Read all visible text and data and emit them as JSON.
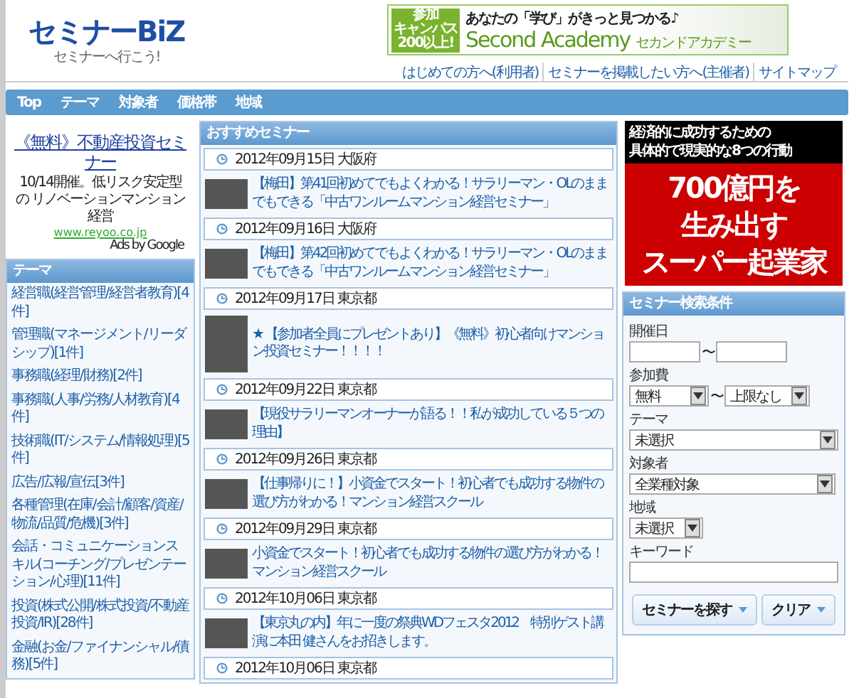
{
  "header": {
    "logo": "セミナーBiZ",
    "tagline": "セミナーへ行こう!",
    "banner": {
      "badge": [
        "参加",
        "キャンパス",
        "200以上!"
      ],
      "catch": "あなたの「学び」がきっと見つかる♪",
      "brand": "Second Academy",
      "brand_kana": "セカンドアカデミー"
    },
    "links": [
      "はじめての方へ(利用者)",
      "セミナーを掲載したい方へ(主催者)",
      "サイトマップ"
    ]
  },
  "nav": [
    "Top",
    "テーマ",
    "対象者",
    "価格帯",
    "地域"
  ],
  "ad": {
    "title": "《無料》不動産投資セミナー",
    "text": "10/14開催。低リスク安定型の リノベーションマンション経営",
    "url": "www.reyoo.co.jp",
    "credit": "Ads by Google"
  },
  "themes": {
    "title": "テーマ",
    "items": [
      "経営職(経営管理/経営者教育)[4件]",
      "管理職(マネージメント/リーダシップ)[1件]",
      "事務職(経理/財務)[2件]",
      "事務職(人事/労務/人材教育)[4件]",
      "技術職(IT/システム/情報処理)[5件]",
      "広告/広報/宣伝[3件]",
      "各種管理(在庫/会計/顧客/資産/物流/品質/危機)[3件]",
      "会話・コミュニケーションスキル(コーチング/プレゼンテーション/心理)[11件]",
      "投資(株式公開/株式投資/不動産投資/IR)[28件]",
      "金融(お金/ファイナンシャル/債務)[5件]"
    ]
  },
  "recommended": {
    "title": "おすすめセミナー",
    "items": [
      {
        "date": "2012年09月15日 大阪府",
        "tall": false,
        "title": "【梅田】第41回初めてでもよくわかる！サラリーマン・OLのままでもできる「中古ワンルームマンション経営セミナー」"
      },
      {
        "date": "2012年09月16日 大阪府",
        "tall": false,
        "title": "【梅田】第42回初めてでもよくわかる！サラリーマン・OLのままでもできる「中古ワンルームマンション経営セミナー」"
      },
      {
        "date": "2012年09月17日 東京都",
        "title": "★ 【参加者全員にプレゼントあり】《無料》初心者向けマンション投資セミナー！！！！",
        "tall": true
      },
      {
        "date": "2012年09月22日 東京都",
        "tall": false,
        "title": "【現役サラリーマンオーナーが語る！！私が成功している５つの理由】"
      },
      {
        "date": "2012年09月26日 東京都",
        "tall": false,
        "title": "【仕事帰りに！】小資金でスタート！初心者でも成功する物件の選び方がわかる！マンション経営スクール"
      },
      {
        "date": "2012年09月29日 東京都",
        "tall": false,
        "title": "小資金でスタート！初心者でも成功する物件の選び方がわかる！マンション経営スクール"
      },
      {
        "date": "2012年10月06日 東京都",
        "tall": false,
        "title": "【東京丸の内】年に一度の祭典WDフェスタ2012　特別ゲスト講演に本田 健さんをお招きします。"
      },
      {
        "date": "2012年10月06日 東京都"
      }
    ]
  },
  "promo": {
    "top": [
      "経済的に成功するための",
      "具体的で現実的な8つの行動"
    ],
    "main": [
      "700億円を",
      "生み出す",
      "スーパー起業家"
    ]
  },
  "search": {
    "title": "セミナー検索条件",
    "date_label": "開催日",
    "fee_label": "参加費",
    "fee_from": "無料",
    "fee_to": "上限なし",
    "range_mark": [
      "〜",
      "〜"
    ],
    "theme_label": "テーマ",
    "theme_value": "未選択",
    "audience_label": "対象者",
    "audience_value": "全業種対象",
    "region_label": "地域",
    "region_value": "未選択",
    "keyword_label": "キーワード",
    "buttons": [
      "セミナーを探す",
      "クリア"
    ]
  }
}
